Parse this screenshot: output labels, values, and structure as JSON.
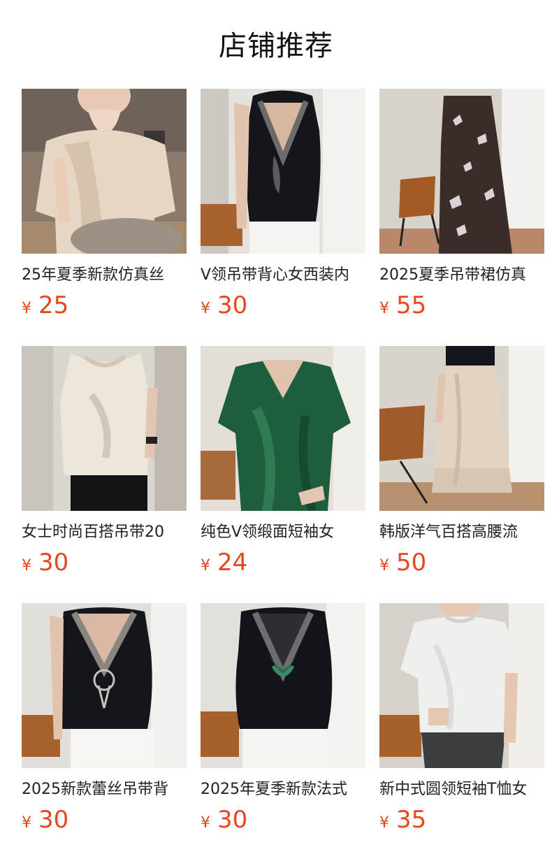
{
  "header": {
    "title": "店铺推荐"
  },
  "currency_symbol": "¥",
  "products": [
    {
      "title": "25年夏季新款仿真丝",
      "price": "25",
      "image_icon": "cream-satin-top-photo"
    },
    {
      "title": "V领吊带背心女西装内",
      "price": "30",
      "image_icon": "black-lace-vest-photo"
    },
    {
      "title": "2025夏季吊带裙仿真",
      "price": "55",
      "image_icon": "butterfly-print-slip-dress-photo"
    },
    {
      "title": "女士时尚百搭吊带20",
      "price": "30",
      "image_icon": "ivory-satin-tank-photo"
    },
    {
      "title": "纯色V领缎面短袖女",
      "price": "24",
      "image_icon": "green-satin-tee-photo"
    },
    {
      "title": "韩版洋气百搭高腰流",
      "price": "50",
      "image_icon": "beige-satin-skirt-photo"
    },
    {
      "title": "2025新款蕾丝吊带背",
      "price": "30",
      "image_icon": "black-embroidered-vest-photo"
    },
    {
      "title": "2025年夏季新款法式",
      "price": "30",
      "image_icon": "black-green-lace-vest-photo"
    },
    {
      "title": "新中式圆领短袖T恤女",
      "price": "35",
      "image_icon": "white-jacquard-tee-photo"
    }
  ]
}
